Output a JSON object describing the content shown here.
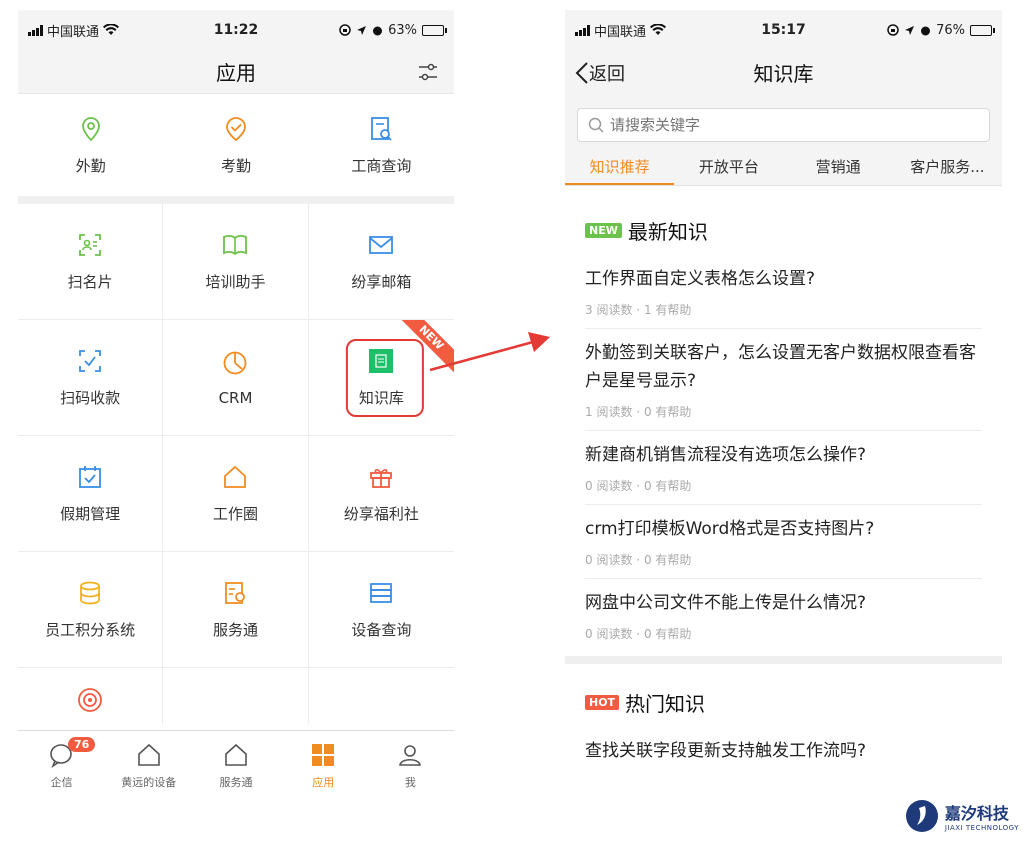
{
  "left": {
    "status": {
      "carrier": "中国联通",
      "time": "11:22",
      "battery": "63%",
      "battery_level": 0.63
    },
    "title": "应用",
    "top_row": [
      {
        "label": "外勤",
        "icon": "location-icon",
        "color": "#6cc24a"
      },
      {
        "label": "考勤",
        "icon": "checkin-icon",
        "color": "#f08c1f"
      },
      {
        "label": "工商查询",
        "icon": "doc-search-icon",
        "color": "#3a8ee6"
      }
    ],
    "grid": [
      {
        "label": "扫名片",
        "icon": "scan-card-icon",
        "color": "#6cc24a"
      },
      {
        "label": "培训助手",
        "icon": "book-icon",
        "color": "#6cc24a"
      },
      {
        "label": "纷享邮箱",
        "icon": "mail-icon",
        "color": "#3a8ee6"
      },
      {
        "label": "扫码收款",
        "icon": "scan-pay-icon",
        "color": "#3a8ee6"
      },
      {
        "label": "CRM",
        "icon": "clock-chart-icon",
        "color": "#f08c1f"
      },
      {
        "label": "知识库",
        "icon": "knowledge-icon",
        "color": "#1fbf6a"
      },
      {
        "label": "假期管理",
        "icon": "calendar-icon",
        "color": "#3a8ee6"
      },
      {
        "label": "工作圈",
        "icon": "home-icon",
        "color": "#f08c1f"
      },
      {
        "label": "纷享福利社",
        "icon": "gift-icon",
        "color": "#f25b3f"
      },
      {
        "label": "员工积分系统",
        "icon": "coins-icon",
        "color": "#f0b21f"
      },
      {
        "label": "服务通",
        "icon": "service-icon",
        "color": "#f08c1f"
      },
      {
        "label": "设备查询",
        "icon": "device-list-icon",
        "color": "#3a8ee6"
      },
      {
        "label": "",
        "icon": "broadcast-icon",
        "color": "#f25b3f"
      },
      {
        "label": "",
        "icon": "",
        "color": ""
      },
      {
        "label": "",
        "icon": "",
        "color": ""
      }
    ],
    "new_ribbon": "NEW",
    "tabs": [
      {
        "label": "企信",
        "badge": "76"
      },
      {
        "label": "黄远的设备"
      },
      {
        "label": "服务通"
      },
      {
        "label": "应用",
        "active": true
      },
      {
        "label": "我"
      }
    ]
  },
  "right": {
    "status": {
      "carrier": "中国联通",
      "time": "15:17",
      "battery": "76%",
      "battery_level": 0.76
    },
    "back": "返回",
    "title": "知识库",
    "search_placeholder": "请搜索关键字",
    "tabs": [
      "知识推荐",
      "开放平台",
      "营销通",
      "客户服务..."
    ],
    "latest": {
      "tag": "NEW",
      "title": "最新知识",
      "items": [
        {
          "q": "工作界面自定义表格怎么设置?",
          "reads": "3",
          "helps": "1"
        },
        {
          "q": "外勤签到关联客户，怎么设置无客户数据权限查看客户是星号显示?",
          "reads": "1",
          "helps": "0"
        },
        {
          "q": "新建商机销售流程没有选项怎么操作?",
          "reads": "0",
          "helps": "0"
        },
        {
          "q": "crm打印模板Word格式是否支持图片?",
          "reads": "0",
          "helps": "0"
        },
        {
          "q": "网盘中公司文件不能上传是什么情况?",
          "reads": "0",
          "helps": "0"
        }
      ]
    },
    "hot": {
      "tag": "HOT",
      "title": "热门知识",
      "items": [
        {
          "q": "查找关联字段更新支持触发工作流吗?"
        }
      ]
    },
    "read_label": "阅读数",
    "help_label": "有帮助"
  },
  "logo": {
    "cn": "嘉汐科技",
    "en": "JIAXI TECHNOLOGY"
  },
  "colors": {
    "accent": "#f08c1f",
    "highlight": "#e53935"
  }
}
